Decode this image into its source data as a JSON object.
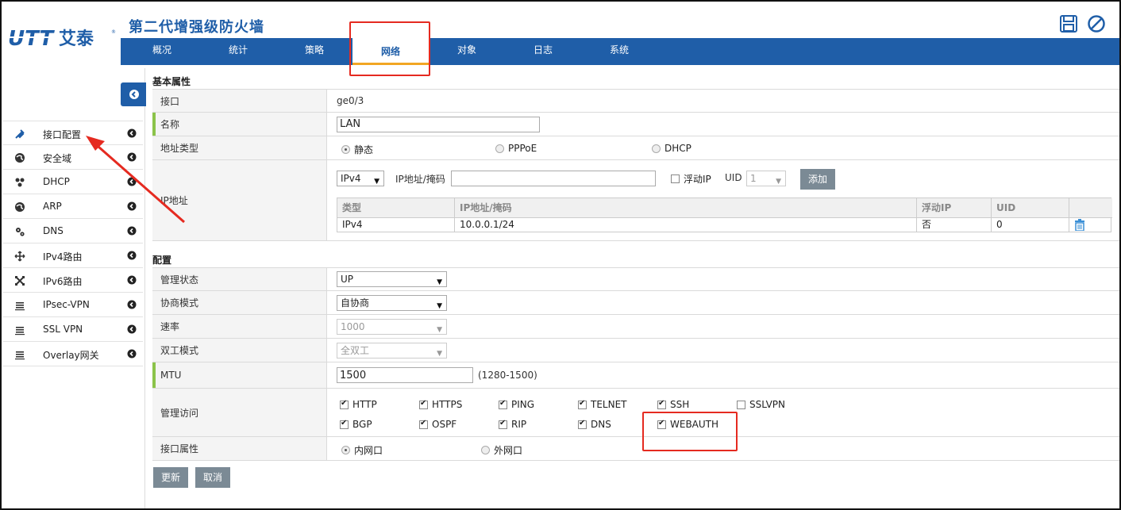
{
  "app": {
    "title": "第二代增强级防火墙",
    "logo_text": "UTT 艾泰"
  },
  "nav": {
    "items": [
      "概况",
      "统计",
      "策略",
      "网络",
      "对象",
      "日志",
      "系统"
    ],
    "active": "网络"
  },
  "sidebar": {
    "items": [
      {
        "label": "接口配置",
        "icon": "plug-icon"
      },
      {
        "label": "安全域",
        "icon": "globe-icon"
      },
      {
        "label": "DHCP",
        "icon": "network-nodes-icon"
      },
      {
        "label": "ARP",
        "icon": "globe-icon"
      },
      {
        "label": "DNS",
        "icon": "gears-icon"
      },
      {
        "label": "IPv4路由",
        "icon": "arrows-icon"
      },
      {
        "label": "IPv6路由",
        "icon": "cross-arrows-icon"
      },
      {
        "label": "IPsec-VPN",
        "icon": "list-icon"
      },
      {
        "label": "SSL VPN",
        "icon": "list-icon"
      },
      {
        "label": "Overlay网关",
        "icon": "list-icon"
      }
    ]
  },
  "basic": {
    "section_title": "基本属性",
    "interface_label": "接口",
    "interface_value": "ge0/3",
    "name_label": "名称",
    "name_value": "LAN",
    "addr_type_label": "地址类型",
    "addr_types": [
      "静态",
      "PPPoE",
      "DHCP"
    ],
    "addr_type_selected": "静态",
    "ip_label": "IP地址",
    "ip_version": "IPv4",
    "ip_mask_label": "IP地址/掩码",
    "ip_mask_value": "",
    "float_ip_label": "浮动IP",
    "uid_label": "UID",
    "uid_value": "1",
    "add_button": "添加",
    "ip_table": {
      "headers": [
        "类型",
        "IP地址/掩码",
        "浮动IP",
        "UID"
      ],
      "rows": [
        [
          "IPv4",
          "10.0.0.1/24",
          "否",
          "0"
        ]
      ]
    }
  },
  "config": {
    "section_title": "配置",
    "admin_state_label": "管理状态",
    "admin_state_value": "UP",
    "negotiation_label": "协商模式",
    "negotiation_value": "自协商",
    "speed_label": "速率",
    "speed_value": "1000",
    "duplex_label": "双工模式",
    "duplex_value": "全双工",
    "mtu_label": "MTU",
    "mtu_value": "1500",
    "mtu_range": "(1280-1500)",
    "mgmt_access_label": "管理访问",
    "mgmt_access": [
      {
        "label": "HTTP",
        "checked": true
      },
      {
        "label": "HTTPS",
        "checked": true
      },
      {
        "label": "PING",
        "checked": true
      },
      {
        "label": "TELNET",
        "checked": true
      },
      {
        "label": "SSH",
        "checked": true
      },
      {
        "label": "SSLVPN",
        "checked": false
      },
      {
        "label": "BGP",
        "checked": true
      },
      {
        "label": "OSPF",
        "checked": true
      },
      {
        "label": "RIP",
        "checked": true
      },
      {
        "label": "DNS",
        "checked": true
      },
      {
        "label": "WEBAUTH",
        "checked": true
      }
    ],
    "iface_attr_label": "接口属性",
    "iface_attrs": [
      "内网口",
      "外网口"
    ],
    "iface_attr_selected": "内网口"
  },
  "actions": {
    "update": "更新",
    "cancel": "取消"
  },
  "colors": {
    "brand_blue": "#1f5ea8",
    "highlight_red": "#e52a20",
    "active_tab_underline": "#f2a623",
    "required_marker": "#8bc34a"
  }
}
